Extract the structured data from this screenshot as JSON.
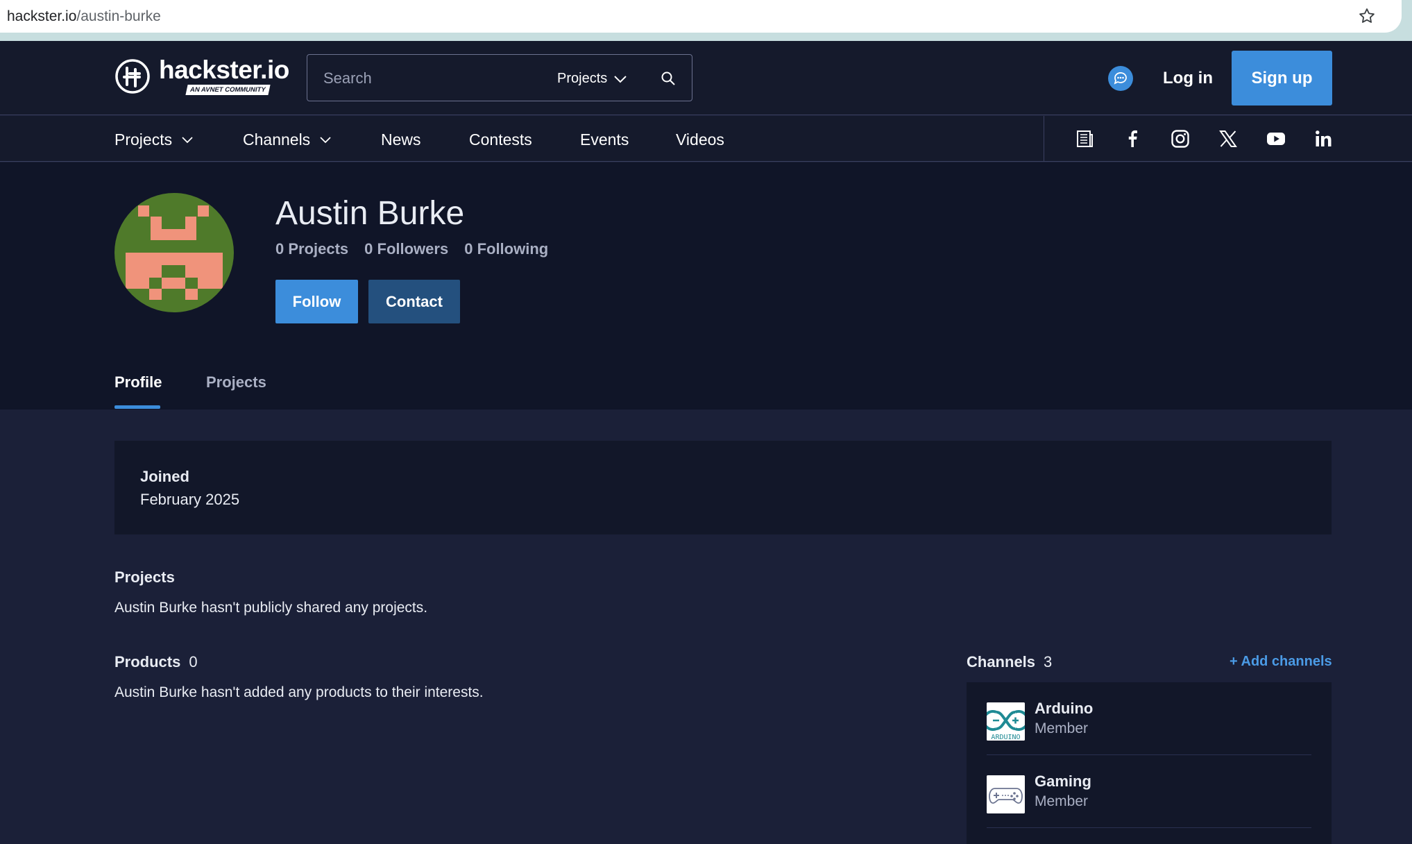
{
  "browser": {
    "url_host": "hackster.io",
    "url_path": "/austin-burke"
  },
  "header": {
    "logo_name": "hackster.io",
    "logo_sub": "AN AVNET COMMUNITY",
    "search_placeholder": "Search",
    "search_scope": "Projects",
    "login_label": "Log in",
    "signup_label": "Sign up"
  },
  "nav": {
    "items": [
      {
        "label": "Projects"
      },
      {
        "label": "Channels"
      },
      {
        "label": "News"
      },
      {
        "label": "Contests"
      },
      {
        "label": "Events"
      },
      {
        "label": "Videos"
      }
    ],
    "social": [
      "newsletter-icon",
      "facebook-icon",
      "instagram-icon",
      "x-icon",
      "youtube-icon",
      "linkedin-icon"
    ]
  },
  "profile": {
    "name": "Austin Burke",
    "stats": {
      "projects": "0 Projects",
      "followers": "0 Followers",
      "following": "0 Following"
    },
    "follow_label": "Follow",
    "contact_label": "Contact",
    "tabs": [
      {
        "label": "Profile",
        "active": true
      },
      {
        "label": "Projects",
        "active": false
      }
    ],
    "avatar_colors": {
      "background": "#4f7a2a",
      "pattern": "#f0937b"
    }
  },
  "main": {
    "joined_label": "Joined",
    "joined_value": "February 2025",
    "projects_title": "Projects",
    "projects_text": "Austin Burke hasn't publicly shared any projects.",
    "products_title": "Products",
    "products_count": "0",
    "products_text": "Austin Burke hasn't added any products to their interests.",
    "channels_title": "Channels",
    "channels_count": "3",
    "add_channels_label": "+ Add channels",
    "channels": [
      {
        "name": "Arduino",
        "role": "Member",
        "icon": "arduino-logo-icon"
      },
      {
        "name": "Gaming",
        "role": "Member",
        "icon": "gamepad-icon"
      }
    ]
  },
  "colors": {
    "accent": "#3c8ddb",
    "page_bg": "#1b2038",
    "header_bg": "#151a2c",
    "hero_bg": "#101528"
  }
}
